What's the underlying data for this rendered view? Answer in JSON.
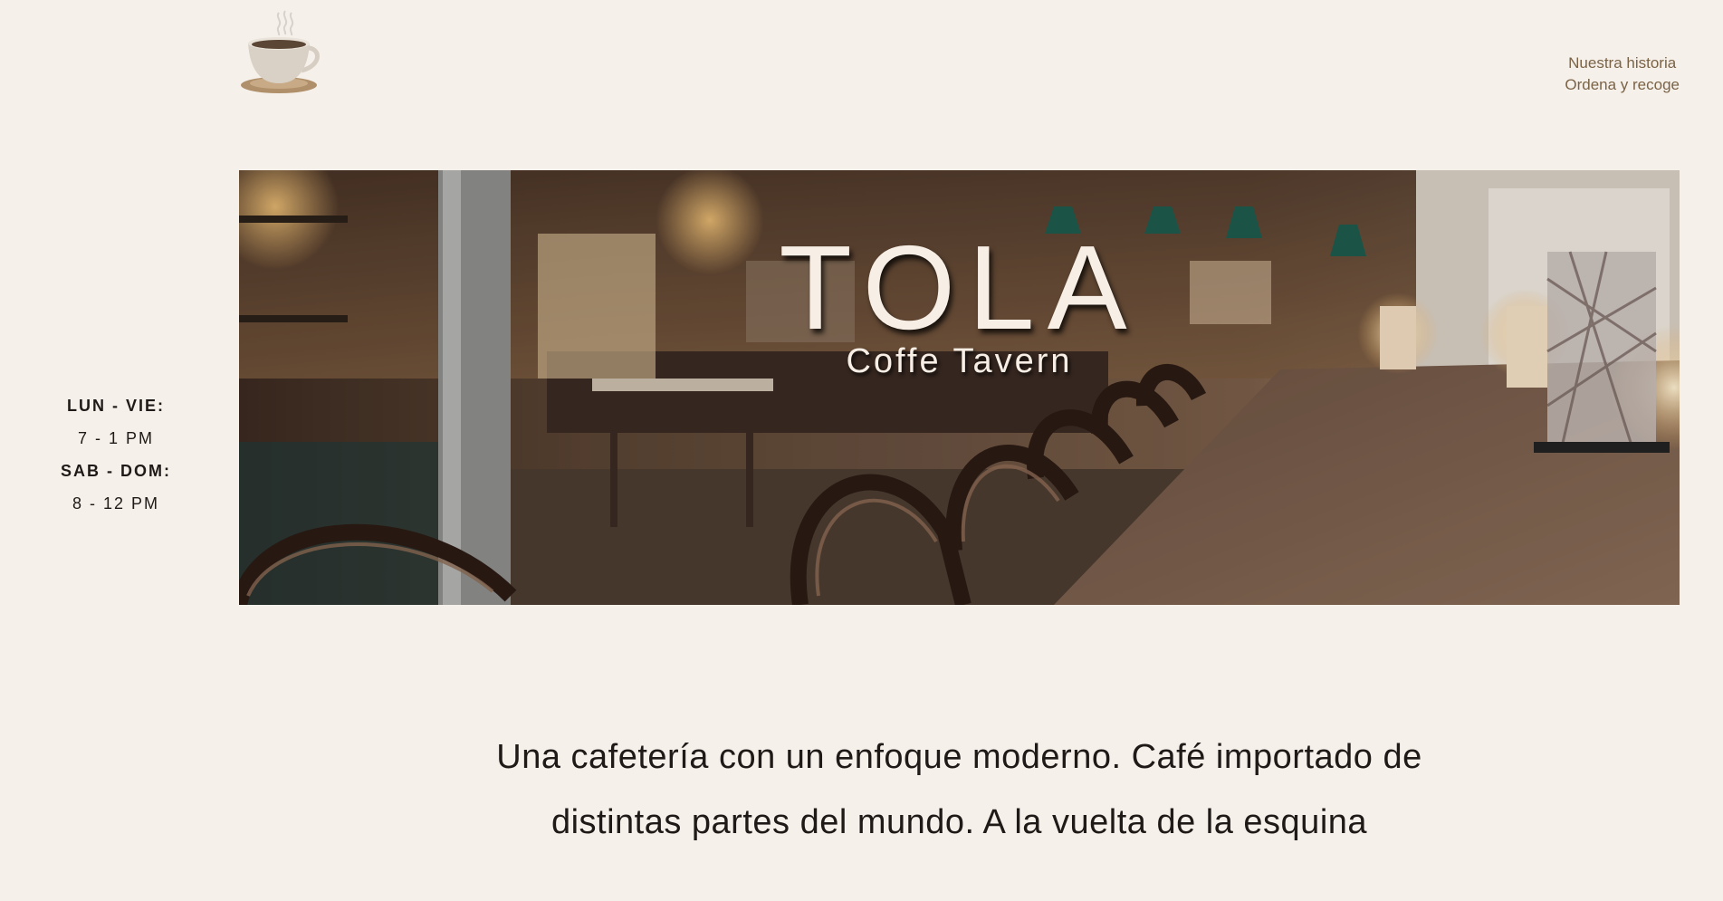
{
  "brand": {
    "logo_icon": "coffee-cup-icon"
  },
  "nav": {
    "items": [
      {
        "label": "Nuestra historia"
      },
      {
        "label": "Ordena y recoge"
      }
    ]
  },
  "hours": {
    "weekdays_label": "LUN - VIE:",
    "weekdays_time": "7 - 1 PM",
    "weekend_label": "SAB - DOM:",
    "weekend_time": "8 - 12 PM"
  },
  "hero": {
    "title": "TOLA",
    "subtitle": "Coffe Tavern"
  },
  "tagline": {
    "line1": "Una cafetería con un enfoque moderno. Café importado de",
    "line2": "distintas partes del mundo. A la vuelta de la esquina"
  },
  "colors": {
    "background": "#f6f0ea",
    "nav_text": "#7a6346",
    "body_text": "#1f1a17",
    "hero_text": "#f7efe6"
  }
}
